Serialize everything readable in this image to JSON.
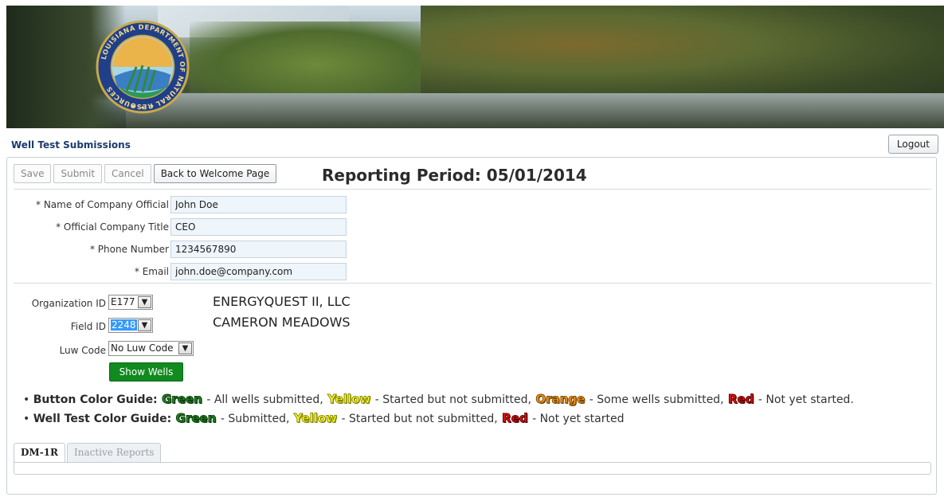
{
  "header": {
    "app_title": "Well Test Submissions",
    "logout_label": "Logout"
  },
  "toolbar": {
    "save_label": "Save",
    "submit_label": "Submit",
    "cancel_label": "Cancel",
    "back_label": "Back to Welcome Page"
  },
  "reporting_period": "Reporting Period: 05/01/2014",
  "official": {
    "name_label": "* Name of Company Official",
    "name_value": "John Doe",
    "title_label": "* Official Company Title",
    "title_value": "CEO",
    "phone_label": "* Phone Number",
    "phone_value": "1234567890",
    "email_label": "* Email",
    "email_value": "john.doe@company.com"
  },
  "selectors": {
    "org_label": "Organization ID",
    "org_value": "E177",
    "org_name": "ENERGYQUEST II, LLC",
    "field_label": "Field ID",
    "field_value": "2248",
    "field_name": "CAMERON MEADOWS",
    "luw_label": "Luw Code",
    "luw_value": "No Luw Code",
    "show_wells_label": "Show Wells"
  },
  "guides": {
    "button_title": "Button Color Guide:",
    "button_green": "Green",
    "button_green_desc": " - All wells submitted, ",
    "button_yellow": "Yellow",
    "button_yellow_desc": " - Started but not submitted, ",
    "button_orange": "Orange",
    "button_orange_desc": " - Some wells submitted, ",
    "button_red": "Red",
    "button_red_desc": " - Not yet started.",
    "well_title": "Well Test Color Guide:",
    "well_green": "Green",
    "well_green_desc": " - Submitted, ",
    "well_yellow": "Yellow",
    "well_yellow_desc": " - Started but not submitted, ",
    "well_red": "Red",
    "well_red_desc": " - Not yet started"
  },
  "tabs": [
    {
      "label": "DM-1R"
    },
    {
      "label": "Inactive Reports"
    }
  ],
  "seal": {
    "text": "LOUISIANA DEPARTMENT OF NATURAL RESOURCES"
  },
  "colors": {
    "title_blue": "#1b3b6b",
    "show_wells_green": "#118a1f",
    "guide_green": "#1f8f1f",
    "guide_yellow": "#ffff33",
    "guide_orange": "#ff9d1f",
    "guide_red": "#ee1111"
  }
}
